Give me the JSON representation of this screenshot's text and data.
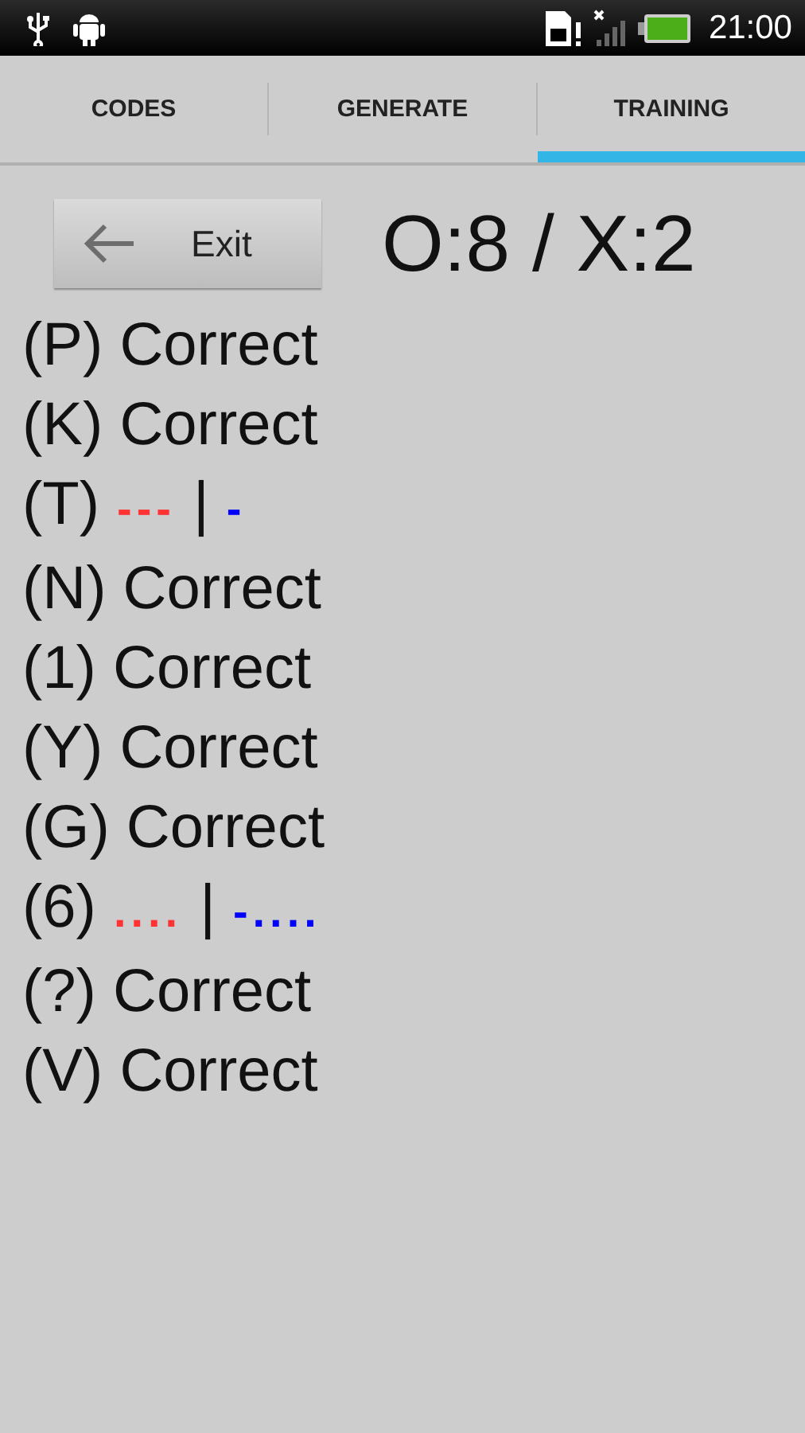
{
  "status_bar": {
    "time": "21:00"
  },
  "tabs": [
    {
      "label": "CODES",
      "selected": false
    },
    {
      "label": "GENERATE",
      "selected": false
    },
    {
      "label": "TRAINING",
      "selected": true
    }
  ],
  "exit_button": {
    "label": "Exit"
  },
  "score": "O:8 / X:2",
  "results": [
    {
      "kind": "correct",
      "symbol": "(P)",
      "text": "Correct"
    },
    {
      "kind": "correct",
      "symbol": "(K)",
      "text": "Correct"
    },
    {
      "kind": "wrong",
      "symbol": "(T)",
      "answer": "---",
      "separator": "|",
      "expected": "-"
    },
    {
      "kind": "correct",
      "symbol": "(N)",
      "text": "Correct"
    },
    {
      "kind": "correct",
      "symbol": "(1)",
      "text": "Correct"
    },
    {
      "kind": "correct",
      "symbol": "(Y)",
      "text": "Correct"
    },
    {
      "kind": "correct",
      "symbol": "(G)",
      "text": "Correct"
    },
    {
      "kind": "wrong",
      "symbol": "(6)",
      "answer": "....",
      "separator": "|",
      "expected": "-...."
    },
    {
      "kind": "correct",
      "symbol": "(?)",
      "text": "Correct"
    },
    {
      "kind": "correct",
      "symbol": "(V)",
      "text": "Correct"
    }
  ]
}
